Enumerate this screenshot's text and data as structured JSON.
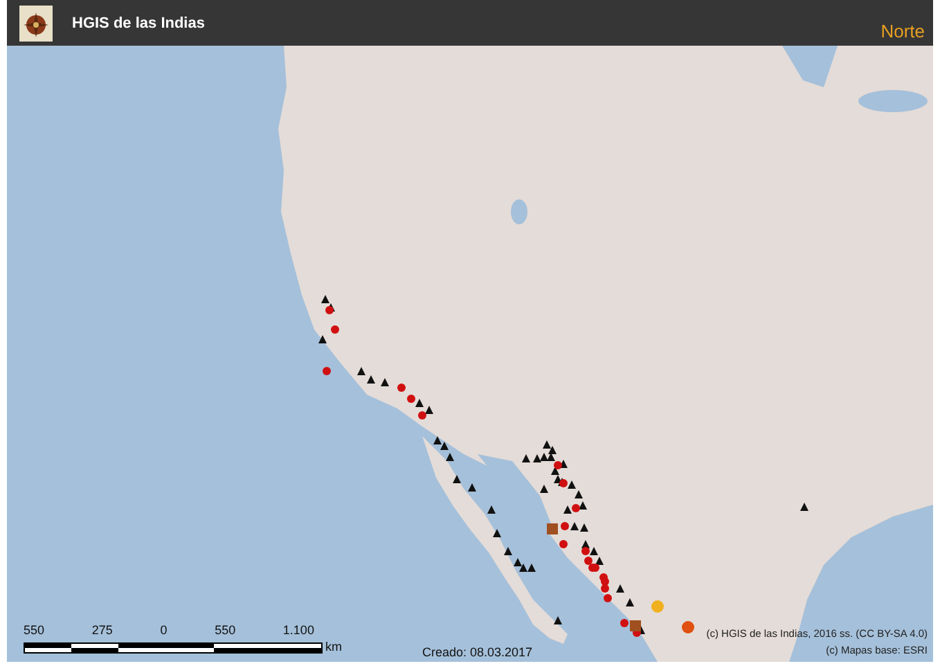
{
  "header": {
    "title": "HGIS de las Indias",
    "region": "Norte"
  },
  "scale_bar": {
    "labels": [
      "550",
      "275",
      "0",
      "550",
      "1.100"
    ],
    "unit": "km"
  },
  "created": "Creado: 08.03.2017",
  "attribution": [
    "(c) HGIS de las Indias, 2016 ss. (CC BY-SA 4.0)",
    "(c) Mapas base: ESRI"
  ]
}
